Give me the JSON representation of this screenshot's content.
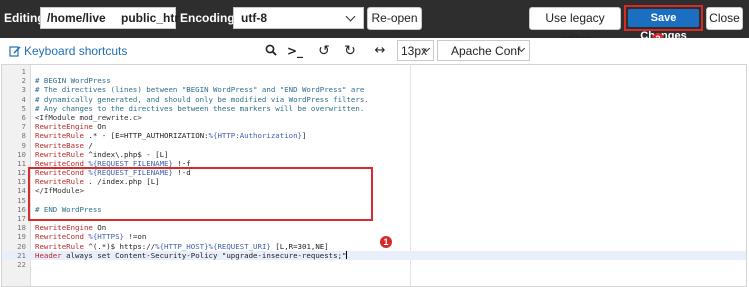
{
  "header": {
    "editing_label": "Editing:",
    "path_part1": "/home/live",
    "path_part2": "public_htr",
    "encoding_label": "Encoding:",
    "encoding_value": "utf-8",
    "reopen_label": "Re-open",
    "legacy_label": "Use legacy editor",
    "save_label": "Save Changes",
    "close_label": "Close"
  },
  "toolbar": {
    "keyboard_shortcuts": "Keyboard shortcuts",
    "search_glyph": "🔍",
    "goto_glyph": ">_",
    "undo_glyph": "↺",
    "redo_glyph": "↻",
    "wrap_glyph": "↔",
    "font_size": "13px",
    "mode": "Apache Conf"
  },
  "markers": {
    "save_marker": "2",
    "code_marker": "1"
  },
  "colors": {
    "accent_blue": "#1c6ec0",
    "highlight_red": "#d72b2b",
    "topbar": "#2e2e2e"
  },
  "code_lines": [
    {
      "n": "1",
      "segs": [
        {
          "t": "",
          "c": "c-text"
        }
      ]
    },
    {
      "n": "2",
      "segs": [
        {
          "t": "# BEGIN WordPress",
          "c": "c-comment"
        }
      ]
    },
    {
      "n": "3",
      "segs": [
        {
          "t": "# The directives (lines) between \"BEGIN WordPress\" and \"END WordPress\" are",
          "c": "c-comment"
        }
      ]
    },
    {
      "n": "4",
      "segs": [
        {
          "t": "# dynamically generated, and should only be modified via WordPress filters.",
          "c": "c-comment"
        }
      ]
    },
    {
      "n": "5",
      "segs": [
        {
          "t": "# Any changes to the directives between these markers will be overwritten.",
          "c": "c-comment"
        }
      ]
    },
    {
      "n": "6",
      "segs": [
        {
          "t": "<IfModule mod_rewrite.c>",
          "c": "c-tag"
        }
      ]
    },
    {
      "n": "7",
      "segs": [
        {
          "t": "RewriteEngine",
          "c": "c-kw"
        },
        {
          "t": " On",
          "c": "c-text"
        }
      ]
    },
    {
      "n": "8",
      "segs": [
        {
          "t": "RewriteRule",
          "c": "c-kw"
        },
        {
          "t": " .* - [E=HTTP_AUTHORIZATION:",
          "c": "c-text"
        },
        {
          "t": "%{HTTP:Authorization}",
          "c": "c-var"
        },
        {
          "t": "]",
          "c": "c-text"
        }
      ]
    },
    {
      "n": "9",
      "segs": [
        {
          "t": "RewriteBase",
          "c": "c-kw"
        },
        {
          "t": " /",
          "c": "c-text"
        }
      ]
    },
    {
      "n": "10",
      "segs": [
        {
          "t": "RewriteRule",
          "c": "c-kw"
        },
        {
          "t": " ^index\\.php$ - [L]",
          "c": "c-text"
        }
      ]
    },
    {
      "n": "11",
      "segs": [
        {
          "t": "RewriteCond",
          "c": "c-kw"
        },
        {
          "t": " ",
          "c": "c-text"
        },
        {
          "t": "%{REQUEST_FILENAME}",
          "c": "c-var"
        },
        {
          "t": " !-f",
          "c": "c-text"
        }
      ]
    },
    {
      "n": "12",
      "segs": [
        {
          "t": "RewriteCond",
          "c": "c-kw"
        },
        {
          "t": " ",
          "c": "c-text"
        },
        {
          "t": "%{REQUEST_FILENAME}",
          "c": "c-var"
        },
        {
          "t": " !-d",
          "c": "c-text"
        }
      ]
    },
    {
      "n": "13",
      "segs": [
        {
          "t": "RewriteRule",
          "c": "c-kw"
        },
        {
          "t": " . /index.php [L]",
          "c": "c-text"
        }
      ]
    },
    {
      "n": "14",
      "segs": [
        {
          "t": "</IfModule>",
          "c": "c-tag"
        }
      ]
    },
    {
      "n": "15",
      "segs": [
        {
          "t": "",
          "c": "c-text"
        }
      ]
    },
    {
      "n": "16",
      "segs": [
        {
          "t": "# END WordPress",
          "c": "c-comment"
        }
      ]
    },
    {
      "n": "17",
      "segs": [
        {
          "t": "",
          "c": "c-text"
        }
      ]
    },
    {
      "n": "18",
      "segs": [
        {
          "t": "RewriteEngine",
          "c": "c-kw"
        },
        {
          "t": " On",
          "c": "c-text"
        }
      ]
    },
    {
      "n": "19",
      "segs": [
        {
          "t": "RewriteCond",
          "c": "c-kw"
        },
        {
          "t": " ",
          "c": "c-text"
        },
        {
          "t": "%{HTTPS}",
          "c": "c-var"
        },
        {
          "t": " !=on",
          "c": "c-text"
        }
      ]
    },
    {
      "n": "20",
      "segs": [
        {
          "t": "RewriteRule",
          "c": "c-kw"
        },
        {
          "t": " ^(.*)$ https://",
          "c": "c-text"
        },
        {
          "t": "%{HTTP_HOST}%{REQUEST_URI}",
          "c": "c-var"
        },
        {
          "t": " [L,R=301,NE]",
          "c": "c-text"
        }
      ]
    },
    {
      "n": "21",
      "segs": [
        {
          "t": "Header",
          "c": "c-kw"
        },
        {
          "t": " always set Content-Security-Policy \"upgrade-insecure-requests;\"",
          "c": "c-text"
        }
      ],
      "cursor": true
    },
    {
      "n": "22",
      "segs": [
        {
          "t": "",
          "c": "c-text"
        }
      ]
    }
  ]
}
